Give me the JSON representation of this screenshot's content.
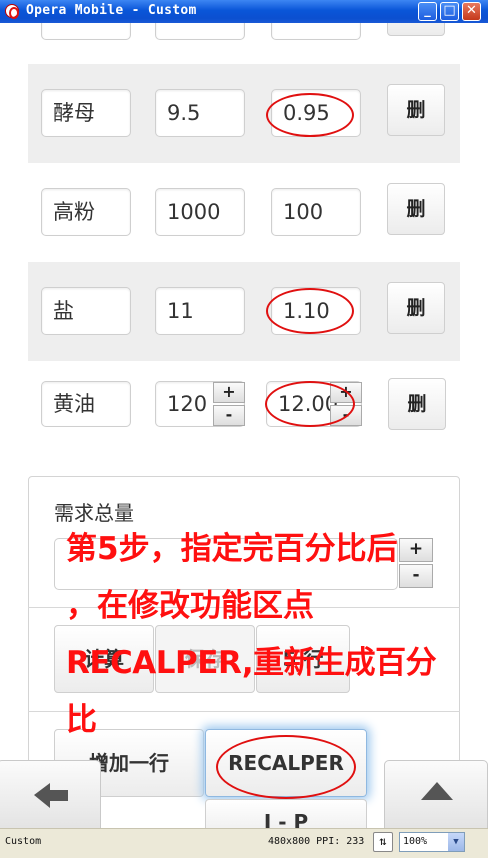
{
  "window": {
    "title": "Opera Mobile - Custom",
    "minimize": "_",
    "maximize": "□",
    "close": "✕"
  },
  "rows": [
    {
      "name": "",
      "amount": "",
      "percent": "",
      "delete_label": ""
    },
    {
      "name": "酵母",
      "amount": "9.5",
      "percent": "0.95",
      "delete_label": "删"
    },
    {
      "name": "高粉",
      "amount": "1000",
      "percent": "100",
      "delete_label": "删"
    },
    {
      "name": "盐",
      "amount": "11",
      "percent": "1.10",
      "delete_label": "删"
    },
    {
      "name": "黄油",
      "amount": "120",
      "percent": "12.00",
      "delete_label": "删"
    }
  ],
  "stepper": {
    "plus": "+",
    "minus": "-"
  },
  "panel": {
    "label": "需求总量",
    "quantity_value": "",
    "calculate_label": "计算",
    "save_label": "保存",
    "third_label": "5 行",
    "add_row_label": "增加一行",
    "recalper_label": "RECALPER",
    "partial_button_label": "I - P"
  },
  "annotation": {
    "lines": [
      "第5步，指定完百分比后",
      "，在修改功能区点",
      "RECALPER,重新生成百分",
      "比"
    ]
  },
  "toolbar": {
    "back_icon": "back-arrow-icon",
    "up_icon": "up-triangle-icon"
  },
  "status": {
    "profile": "Custom",
    "resolution": "480x800 PPI: 233",
    "zoom": "100%"
  },
  "colors": {
    "annotation": "#ff1010",
    "titlebar": "#0a56d8",
    "highlight_glow": "#9ec8ee"
  }
}
